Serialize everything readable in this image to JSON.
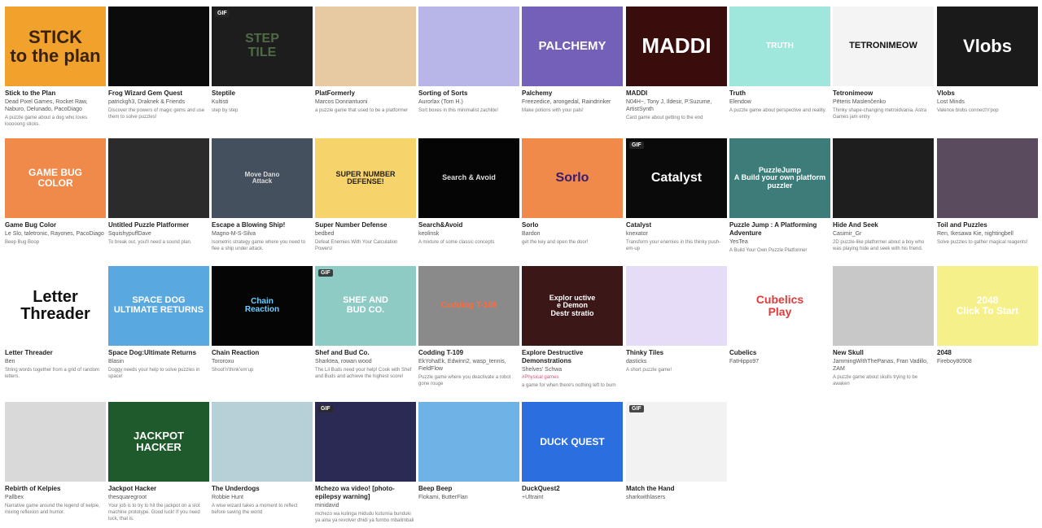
{
  "games": [
    {
      "name": "stick-to-the-plan",
      "title": "Stick to the Plan",
      "author": "Dead Pixel Games, Rocket Raw, Naburo, Delunado, PacoDiago",
      "desc": "A puzzle game about a dog who loves looooong sticks.",
      "thumb_text": "STICK\nto the plan",
      "bg": "#f0a22c",
      "fg": "#3a2212",
      "fs": 22,
      "gif": false
    },
    {
      "name": "frog-wizard-gem-quest",
      "title": "Frog Wizard Gem Quest",
      "author": "patrickgh3, Draknek & Friends",
      "desc": "Discover the powers of magic gems and use them to solve puzzles!",
      "thumb_text": "",
      "bg": "#0b0b0b",
      "fg": "#e33",
      "fs": 10,
      "gif": false
    },
    {
      "name": "steptile",
      "title": "Steptile",
      "author": "Kultisti",
      "desc": "step by step",
      "thumb_text": "STEP\nTILE",
      "bg": "#1d1d1d",
      "fg": "#4e6b45",
      "fs": 16,
      "gif": true
    },
    {
      "name": "platformerly",
      "title": "PlatFormerly",
      "author": "Marcos Donnantuoni",
      "desc": "a puzzle game that used to be a platformer",
      "thumb_text": "",
      "bg": "#e7caa2",
      "fg": "#8a5a33",
      "fs": 10,
      "gif": false
    },
    {
      "name": "sorting-of-sorts",
      "title": "Sorting of Sorts",
      "author": "Aurorlax (Tom H.)",
      "desc": "Sort boxes in this minimalist zachlite!",
      "thumb_text": "",
      "bg": "#b8b6e8",
      "fg": "#333",
      "fs": 10,
      "gif": false
    },
    {
      "name": "palchemy",
      "title": "Palchemy",
      "author": "Freezedice, arongedal, Raindrinker",
      "desc": "Make potions with your pals!",
      "thumb_text": "PALCHEMY",
      "bg": "#7460b8",
      "fg": "#ffffff",
      "fs": 15,
      "gif": false
    },
    {
      "name": "maddi",
      "title": "MADDI",
      "author": "N04H~, Tony J, Ildesir, P.Suzume, ArtistSynth",
      "desc": "Card game about getting to the end",
      "thumb_text": "MADDI",
      "bg": "#3a0d0d",
      "fg": "#ffffff",
      "fs": 26,
      "gif": false
    },
    {
      "name": "truth",
      "title": "Truth",
      "author": "Elendow",
      "desc": "A puzzle game about perspective and reality.",
      "thumb_text": "TRUTH",
      "bg": "#9fe6dc",
      "fg": "#ffffff",
      "fs": 10,
      "gif": false
    },
    {
      "name": "tetronimeow",
      "title": "Tetronimeow",
      "author": "Pēteris Maslenčenko",
      "desc": "Thinky shape-changing metroidvania. Astra Games jam entry",
      "thumb_text": "TETRONIMEOW",
      "bg": "#f4f4f4",
      "fg": "#111",
      "fs": 11,
      "gif": false
    },
    {
      "name": "vlobs",
      "title": "Vlobs",
      "author": "Lost Minds",
      "desc": "Valence blobs connect'n'pop",
      "thumb_text": "Vlobs",
      "bg": "#1a1a1a",
      "fg": "#ffffff",
      "fs": 22,
      "gif": false
    },
    {
      "name": "game-bug-color",
      "title": "Game Bug Color",
      "author": "Le Slo, taletronic, Rayones, PacoDiago",
      "desc": "Beep Bug Boop",
      "thumb_text": "GAME BUG\nCOLOR",
      "bg": "#f08a4b",
      "fg": "#ffffff",
      "fs": 12,
      "gif": false
    },
    {
      "name": "untitled-puzzle-platformer",
      "title": "Untitled Puzzle Platformer",
      "author": "SquishypuffDave",
      "desc": "To break out, you'll need a sound plan.",
      "thumb_text": "",
      "bg": "#2b2b2b",
      "fg": "#fff",
      "fs": 10,
      "gif": false
    },
    {
      "name": "escape-a-blowing-ship",
      "title": "Escape a Blowing Ship!",
      "author": "Magno-M-S-Silva",
      "desc": "Isometric strategy game where you need to flee a ship under attack.",
      "thumb_text": "Move  Dano\nAttack",
      "bg": "#44505e",
      "fg": "#dddddd",
      "fs": 8,
      "gif": false
    },
    {
      "name": "super-number-defense",
      "title": "Super Number Defense",
      "author": "bedbed",
      "desc": "Defeat Enemies With Your Calculation Powers!",
      "thumb_text": "SUPER NUMBER\nDEFENSE!",
      "bg": "#f7d36b",
      "fg": "#222",
      "fs": 9,
      "gif": false
    },
    {
      "name": "search-and-avoid",
      "title": "Search&Avoid",
      "author": "keolinsk",
      "desc": "A mixture of some classic concepts",
      "thumb_text": "Search & Avoid",
      "bg": "#050505",
      "fg": "#dddddd",
      "fs": 9,
      "gif": false
    },
    {
      "name": "sorlo",
      "title": "Sorlo",
      "author": "Bardon",
      "desc": "get the key and open the door!",
      "thumb_text": "Sorlo",
      "bg": "#f08a4b",
      "fg": "#3a1a6a",
      "fs": 16,
      "gif": false
    },
    {
      "name": "catalyst",
      "title": "Catalyst",
      "author": "knexator",
      "desc": "Transform your enemies in this thinky push-em-up",
      "thumb_text": "Catalyst",
      "bg": "#0a0a0a",
      "fg": "#ffffff",
      "fs": 16,
      "gif": true
    },
    {
      "name": "puzzle-jump",
      "title": "Puzzle Jump : A Platforming Adventure",
      "author": "YesTea",
      "desc": "A Build Your Own Puzzle Platformer",
      "thumb_text": "PuzzleJump\nA Build your own platform puzzler",
      "bg": "#3c7d7a",
      "fg": "#ffffff",
      "fs": 9,
      "gif": false
    },
    {
      "name": "hide-and-seek",
      "title": "Hide And Seek",
      "author": "Casimir_Gr",
      "desc": "2D puzzle-like platformer about a boy who was playing hide and seek with his friend.",
      "thumb_text": "",
      "bg": "#1e1e1e",
      "fg": "#fff",
      "fs": 10,
      "gif": false
    },
    {
      "name": "toil-and-puzzles",
      "title": "Toil and Puzzles",
      "author": "Ren, Ikesawa Kie, nightingbell",
      "desc": "Solve puzzles to gather magical reagents!",
      "thumb_text": "",
      "bg": "#5b4b5e",
      "fg": "#fff",
      "fs": 10,
      "gif": false
    },
    {
      "name": "letter-threader",
      "title": "Letter Threader",
      "author": "Ben",
      "desc": "String words together from a grid of random letters.",
      "thumb_text": "Letter\nThreader",
      "bg": "#ffffff",
      "fg": "#111111",
      "fs": 20,
      "gif": false
    },
    {
      "name": "space-dog",
      "title": "Space Dog:Ultimate Returns",
      "author": "Blasin",
      "desc": "Doggy needs your help to solve puzzles in space!",
      "thumb_text": "SPACE DOG\nULTIMATE RETURNS",
      "bg": "#5aa8e0",
      "fg": "#ffffff",
      "fs": 11,
      "gif": false
    },
    {
      "name": "chain-reaction",
      "title": "Chain Reaction",
      "author": "Tororoxu",
      "desc": "Shoot'n'think'em'up",
      "thumb_text": "Chain\nReaction",
      "bg": "#050505",
      "fg": "#6bd0ff",
      "fs": 10,
      "gif": false
    },
    {
      "name": "shef-and-bud-co",
      "title": "Shef and Bud Co.",
      "author": "Sharktea, rowan wood",
      "desc": "The Lil Buds need your help! Cook with Shef and Buds and achieve the highest score!",
      "thumb_text": "SHEF AND\nBUD CO.",
      "bg": "#8ecbc4",
      "fg": "#ffffff",
      "fs": 11,
      "gif": true
    },
    {
      "name": "codding-t-109",
      "title": "Codding T-109",
      "author": "EkYohaEk, Edwinn2, wasp_tennis, FieldFlow",
      "desc": "Puzzle game where you deactivate a robot gone rouge",
      "thumb_text": "Codding T-109",
      "bg": "#8a8a8a",
      "fg": "#ff6b3d",
      "fs": 10,
      "gif": false
    },
    {
      "name": "explore-destructive-demonstrations",
      "title": "Explore Destructive Demonstrations",
      "author": "Shelves' Schwa",
      "desc": "a game for when there's nothing left to burn",
      "tag": "#Physical games",
      "thumb_text": "Explor uctive\ne Demon\nDestr stratio",
      "bg": "#3b1717",
      "fg": "#ffffff",
      "fs": 9,
      "gif": false
    },
    {
      "name": "thinky-tiles",
      "title": "Thinky Tiles",
      "author": "dasticks",
      "desc": "A short puzzle game!",
      "thumb_text": "",
      "bg": "#e6dcf7",
      "fg": "#b388f0",
      "fs": 10,
      "gif": false
    },
    {
      "name": "cubelics",
      "title": "Cubelics",
      "author": "FatHippo97",
      "desc": "",
      "thumb_text": "Cubelics\nPlay",
      "bg": "#ffffff",
      "fg": "#e23a3a",
      "fs": 14,
      "gif": false
    },
    {
      "name": "new-skull",
      "title": "New Skull",
      "author": "JammingWithThePanas, Fran Vadillo, ZAM",
      "desc": "A puzzle game about skulls trying to be awaken",
      "thumb_text": "",
      "bg": "#c8c8c8",
      "fg": "#111",
      "fs": 10,
      "gif": false
    },
    {
      "name": "2048",
      "title": "2048",
      "author": "Fireboy80908",
      "desc": "",
      "thumb_text": "2048\nClick To Start",
      "bg": "#f6f08a",
      "fg": "#ffffff",
      "fs": 12,
      "gif": false
    },
    {
      "name": "rebirth-of-kelpies",
      "title": "Rebirth of Kelpies",
      "author": "Pallbex",
      "desc": "Narrative game around the legend of kelpie, mixing reflexion and humor.",
      "thumb_text": "",
      "bg": "#d9d9d9",
      "fg": "#222",
      "fs": 10,
      "gif": false
    },
    {
      "name": "jackpot-hacker",
      "title": "Jackpot Hacker",
      "author": "thesquaregroot",
      "desc": "Your job is to try to hit the jackpot on a slot machine prototype. Good luck! If you need luck, that is.",
      "thumb_text": "JACKPOT\nHACKER",
      "bg": "#1f5a2c",
      "fg": "#ffffff",
      "fs": 13,
      "gif": false
    },
    {
      "name": "the-underdogs",
      "title": "The Underdogs",
      "author": "Robbie Hunt",
      "desc": "A wise wizard takes a moment to reflect before saving the world",
      "thumb_text": "",
      "bg": "#b7cfd6",
      "fg": "#fff",
      "fs": 10,
      "gif": false
    },
    {
      "name": "mchezo-wa-video",
      "title": "Mchezo wa video! [photo-epilepsy warning]",
      "author": "minidavid",
      "desc": "mchezo wa kulinga midudu kutumia bunduki ya aina ya revolver dhidi ya fumbo mbalimbali",
      "thumb_text": "",
      "bg": "#2a2a55",
      "fg": "#fff",
      "fs": 10,
      "gif": true
    },
    {
      "name": "beep-beep",
      "title": "Beep Beep",
      "author": "Flokami, ButterFlan",
      "desc": "",
      "thumb_text": "",
      "bg": "#6fb2e6",
      "fg": "#fff",
      "fs": 10,
      "gif": false
    },
    {
      "name": "duckquest2",
      "title": "DuckQuest2",
      "author": "+Ultraint",
      "desc": "",
      "thumb_text": "DUCK QUEST",
      "bg": "#2b6ee0",
      "fg": "#ffffff",
      "fs": 12,
      "gif": false
    },
    {
      "name": "match-the-hand",
      "title": "Match the Hand",
      "author": "sharkwithlasers",
      "desc": "",
      "thumb_text": "",
      "bg": "#f2f2f2",
      "fg": "#333",
      "fs": 10,
      "gif": true
    }
  ],
  "gif_label": "GIF"
}
